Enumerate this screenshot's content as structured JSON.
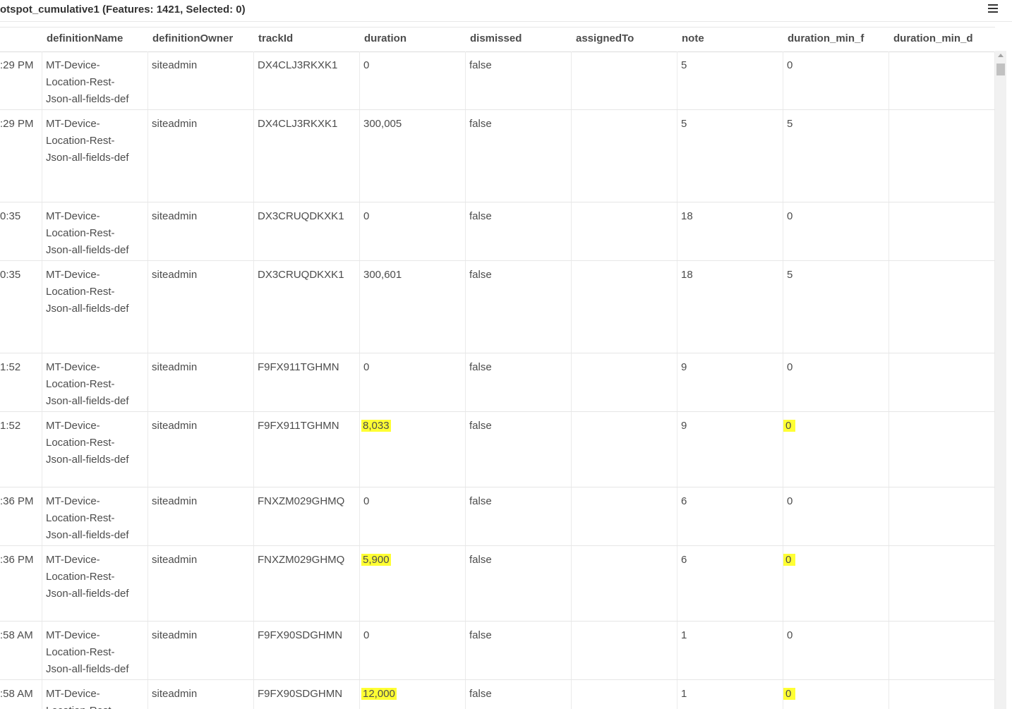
{
  "title": "otspot_cumulative1 (Features: 1421, Selected: 0)",
  "menu_icon": "hamburger-menu-icon",
  "highlight_color": "#ffff33",
  "columns": [
    "definitionName",
    "definitionOwner",
    "trackId",
    "duration",
    "dismissed",
    "assignedTo",
    "note",
    "duration_min_f",
    "duration_min_d"
  ],
  "rows": [
    {
      "time": ":29 PM",
      "name1": "MT-Device-",
      "name2": "Location-Rest-",
      "name3": "Json-all-fields-def",
      "owner": "siteadmin",
      "track": "DX4CLJ3RKXK1",
      "duration": "0",
      "dismissed": "false",
      "assigned": "",
      "note": "5",
      "dmf": "0",
      "dmd": "",
      "highlight": false
    },
    {
      "time": ":29 PM",
      "name1": "MT-Device-",
      "name2": "Location-Rest-",
      "name3": "Json-all-fields-def",
      "owner": "siteadmin",
      "track": "DX4CLJ3RKXK1",
      "duration": "300,005",
      "dismissed": "false",
      "assigned": "",
      "note": "5",
      "dmf": "5",
      "dmd": "",
      "highlight": false
    },
    {
      "time": "0:35",
      "name1": "MT-Device-",
      "name2": "Location-Rest-",
      "name3": "Json-all-fields-def",
      "owner": "siteadmin",
      "track": "DX3CRUQDKXK1",
      "duration": "0",
      "dismissed": "false",
      "assigned": "",
      "note": "18",
      "dmf": "0",
      "dmd": "",
      "highlight": false
    },
    {
      "time": "0:35",
      "name1": "MT-Device-",
      "name2": "Location-Rest-",
      "name3": "Json-all-fields-def",
      "owner": "siteadmin",
      "track": "DX3CRUQDKXK1",
      "duration": "300,601",
      "dismissed": "false",
      "assigned": "",
      "note": "18",
      "dmf": "5",
      "dmd": "",
      "highlight": false
    },
    {
      "time": "1:52",
      "name1": "MT-Device-",
      "name2": "Location-Rest-",
      "name3": "Json-all-fields-def",
      "owner": "siteadmin",
      "track": "F9FX911TGHMN",
      "duration": "0",
      "dismissed": "false",
      "assigned": "",
      "note": "9",
      "dmf": "0",
      "dmd": "",
      "highlight": false
    },
    {
      "time": "1:52",
      "name1": "MT-Device-",
      "name2": "Location-Rest-",
      "name3": "Json-all-fields-def",
      "owner": "siteadmin",
      "track": "F9FX911TGHMN",
      "duration": "8,033",
      "dismissed": "false",
      "assigned": "",
      "note": "9",
      "dmf": "0",
      "dmd": "",
      "highlight": true
    },
    {
      "time": ":36 PM",
      "name1": "MT-Device-",
      "name2": "Location-Rest-",
      "name3": "Json-all-fields-def",
      "owner": "siteadmin",
      "track": "FNXZM029GHMQ",
      "duration": "0",
      "dismissed": "false",
      "assigned": "",
      "note": "6",
      "dmf": "0",
      "dmd": "",
      "highlight": false
    },
    {
      "time": ":36 PM",
      "name1": "MT-Device-",
      "name2": "Location-Rest-",
      "name3": "Json-all-fields-def",
      "owner": "siteadmin",
      "track": "FNXZM029GHMQ",
      "duration": "5,900",
      "dismissed": "false",
      "assigned": "",
      "note": "6",
      "dmf": "0",
      "dmd": "",
      "highlight": true
    },
    {
      "time": ":58 AM",
      "name1": "MT-Device-",
      "name2": "Location-Rest-",
      "name3": "Json-all-fields-def",
      "owner": "siteadmin",
      "track": "F9FX90SDGHMN",
      "duration": "0",
      "dismissed": "false",
      "assigned": "",
      "note": "1",
      "dmf": "0",
      "dmd": "",
      "highlight": false
    },
    {
      "time": ":58 AM",
      "name1": "MT-Device-",
      "name2": "Location-Rest",
      "name3": "",
      "owner": "siteadmin",
      "track": "F9FX90SDGHMN",
      "duration": "12,000",
      "dismissed": "false",
      "assigned": "",
      "note": "1",
      "dmf": "0",
      "dmd": "",
      "highlight": true
    }
  ]
}
